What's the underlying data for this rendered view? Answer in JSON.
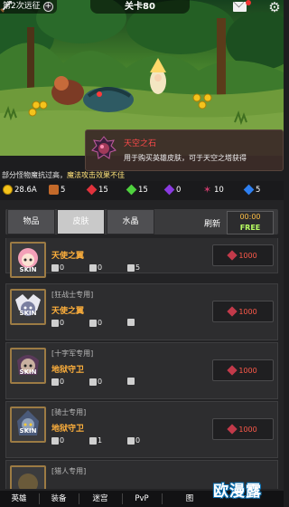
{
  "top_bar": {
    "stage_progress": "第2次远征",
    "plus": "+",
    "level_title": "关卡80",
    "gear": "⚙"
  },
  "tooltip": {
    "title": "天空之石",
    "description": "用于购买英雄皮肤，可于天空之塔获得"
  },
  "notice": {
    "text": "部分怪物魔抗过高，",
    "highlight": "魔法攻击效果不佳"
  },
  "resources": [
    {
      "name": "gold",
      "value": "28.6A",
      "color": "#f4c31c"
    },
    {
      "name": "chest",
      "value": "5",
      "color": "#c46a2a"
    },
    {
      "name": "ruby",
      "value": "15",
      "color": "#e0323c"
    },
    {
      "name": "emerald",
      "value": "15",
      "color": "#4fd13e"
    },
    {
      "name": "amethyst",
      "value": "0",
      "color": "#8a3ae0"
    },
    {
      "name": "spider-star",
      "value": "10",
      "color": "#c83a6a"
    },
    {
      "name": "sapphire",
      "value": "5",
      "color": "#2e7ff0"
    }
  ],
  "tabs": {
    "items": [
      "物品",
      "皮肤",
      "水晶"
    ],
    "active": 1,
    "refresh_label": "刷新",
    "timer": "00:00",
    "free_label": "FREE"
  },
  "skins": [
    {
      "class_tag": "",
      "name": "天使之翼",
      "skin": "SKIN",
      "stat1": "0",
      "stat2": "0",
      "stat3": "5",
      "price": "1000"
    },
    {
      "class_tag": "[狂战士专用]",
      "name": "天使之翼",
      "skin": "SKIN",
      "stat1": "0",
      "stat2": "0",
      "stat3": "",
      "price": "1000"
    },
    {
      "class_tag": "[十字军专用]",
      "name": "地狱守卫",
      "skin": "SKIN",
      "stat1": "0",
      "stat2": "0",
      "stat3": "",
      "price": "1000"
    },
    {
      "class_tag": "[骑士专用]",
      "name": "地狱守卫",
      "skin": "SKIN",
      "stat1": "0",
      "stat2": "1",
      "stat3": "0",
      "price": "1000"
    },
    {
      "class_tag": "[猎人专用]",
      "name": "",
      "skin": "",
      "stat1": "",
      "stat2": "",
      "stat3": "",
      "price": ""
    }
  ],
  "bottom_nav": [
    "英雄",
    "装备",
    "迷宫",
    "PvP",
    "图"
  ],
  "watermark": "欧漫露"
}
